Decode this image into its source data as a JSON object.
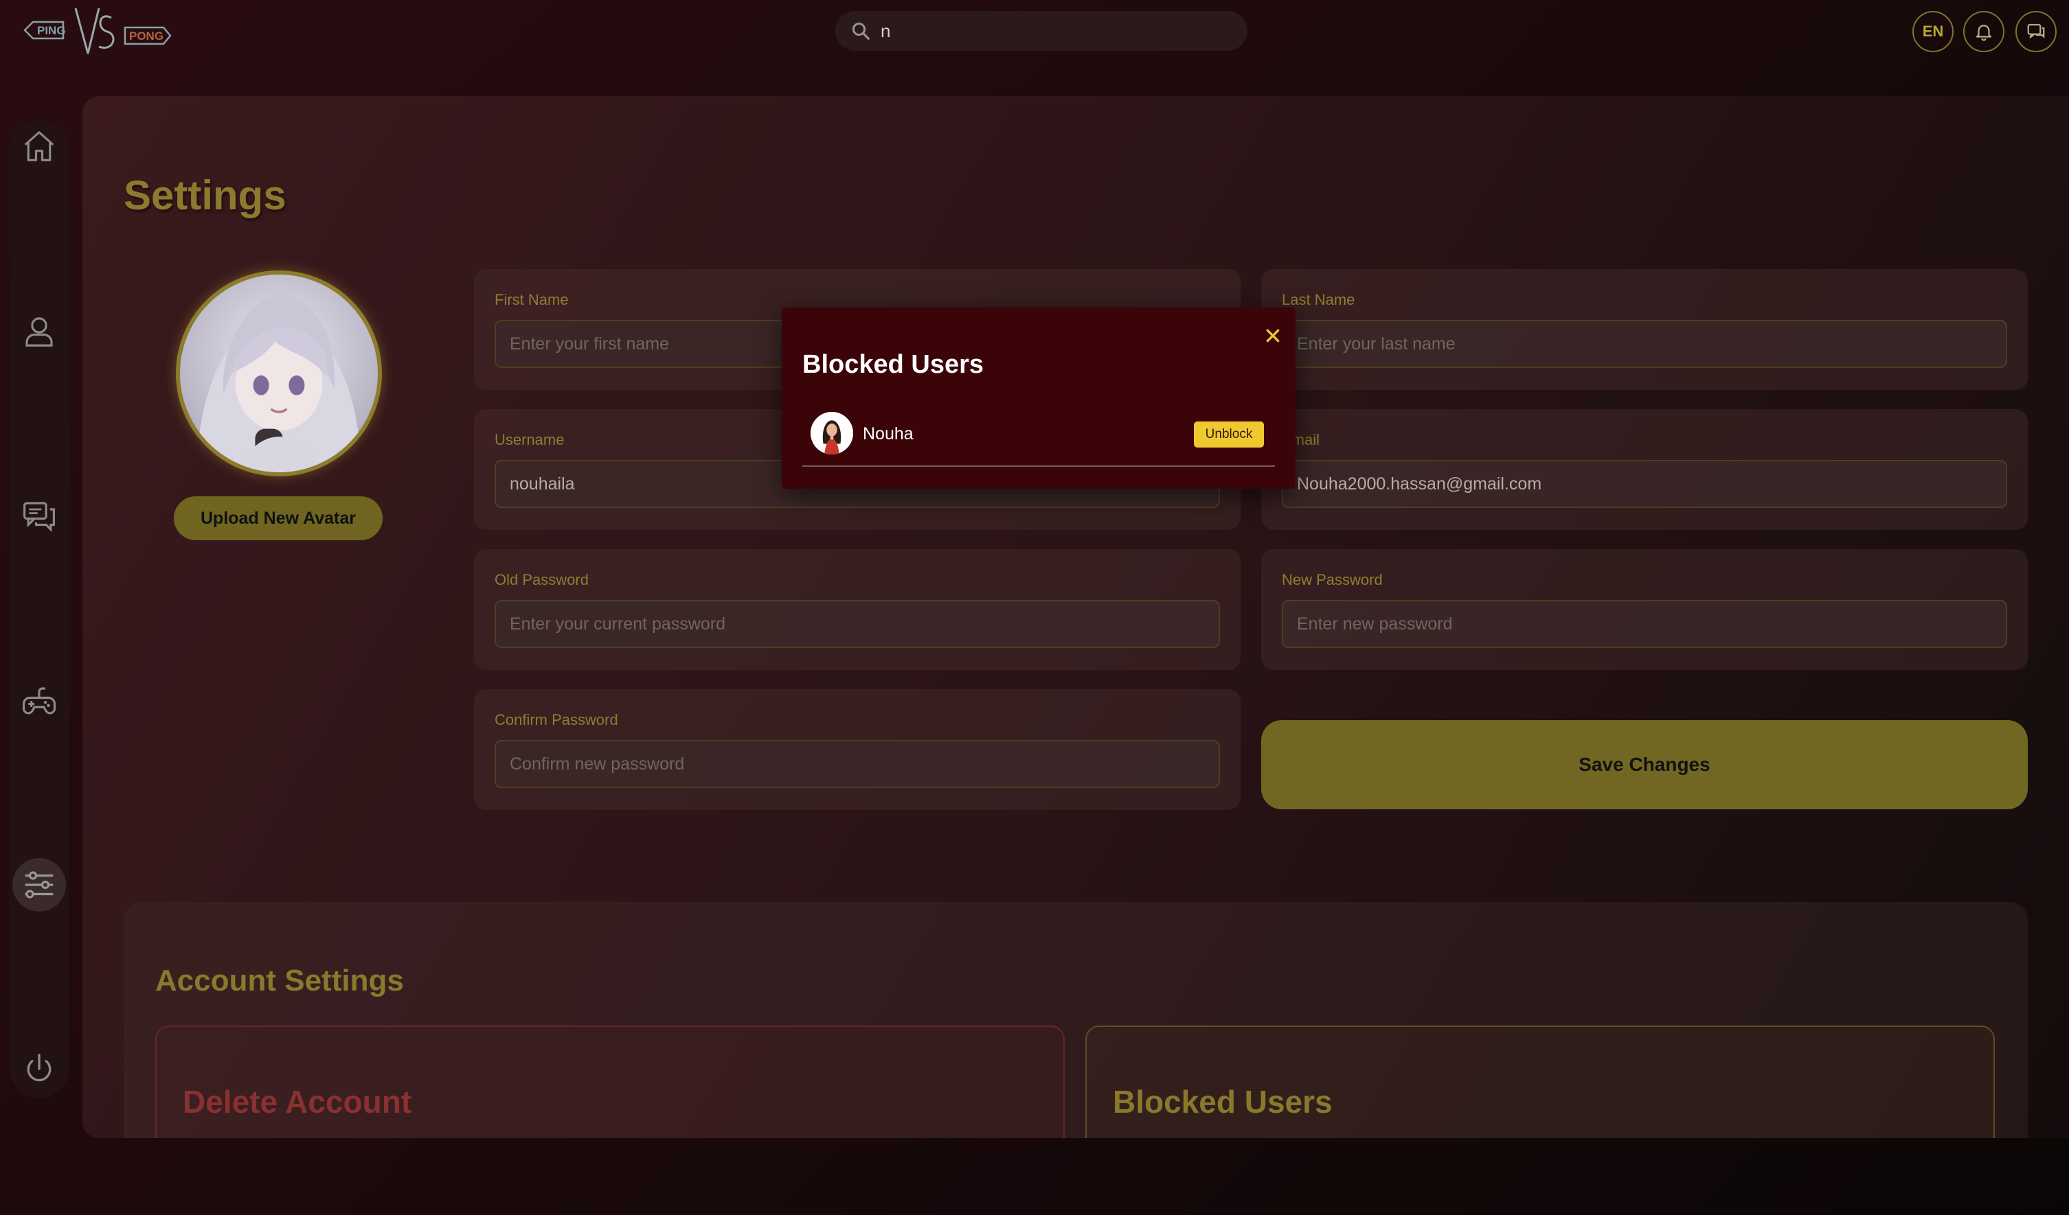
{
  "header": {
    "logo_text_left": "PING",
    "logo_text_right": "PONG",
    "logo_vs": "VS",
    "search_value": "n",
    "language": "EN",
    "icons": [
      "search-icon",
      "bell-icon",
      "chat-icon"
    ]
  },
  "sidebar": {
    "items": [
      {
        "name": "home",
        "icon": "home-icon"
      },
      {
        "name": "profile",
        "icon": "user-icon"
      },
      {
        "name": "chat",
        "icon": "chat-icon"
      },
      {
        "name": "game",
        "icon": "gamepad-icon"
      },
      {
        "name": "settings",
        "icon": "sliders-icon",
        "active": true
      },
      {
        "name": "logout",
        "icon": "power-icon"
      }
    ]
  },
  "settings": {
    "title": "Settings",
    "upload_avatar_label": "Upload New Avatar",
    "fields": {
      "first_name": {
        "label": "First Name",
        "value": "",
        "placeholder": "Enter your first name"
      },
      "last_name": {
        "label": "Last Name",
        "value": "",
        "placeholder": "Enter your last name"
      },
      "username": {
        "label": "Username",
        "value": "nouhaila",
        "placeholder": ""
      },
      "email": {
        "label": "Email",
        "value": "Nouha2000.hassan@gmail.com",
        "placeholder": ""
      },
      "old_password": {
        "label": "Old Password",
        "value": "",
        "placeholder": "Enter your current password"
      },
      "new_password": {
        "label": "New Password",
        "value": "",
        "placeholder": "Enter new password"
      },
      "confirm_password": {
        "label": "Confirm Password",
        "value": "",
        "placeholder": "Confirm new password"
      }
    },
    "save_label": "Save Changes"
  },
  "account_settings": {
    "title": "Account Settings",
    "delete_title": "Delete Account",
    "blocked_title": "Blocked Users"
  },
  "modal": {
    "title": "Blocked Users",
    "users": [
      {
        "name": "Nouha",
        "action": "Unblock"
      }
    ]
  },
  "colors": {
    "accent": "#f0c930",
    "gold_muted": "#8c7a2e",
    "modal_bg": "#3a0409",
    "danger": "#8a3030"
  }
}
